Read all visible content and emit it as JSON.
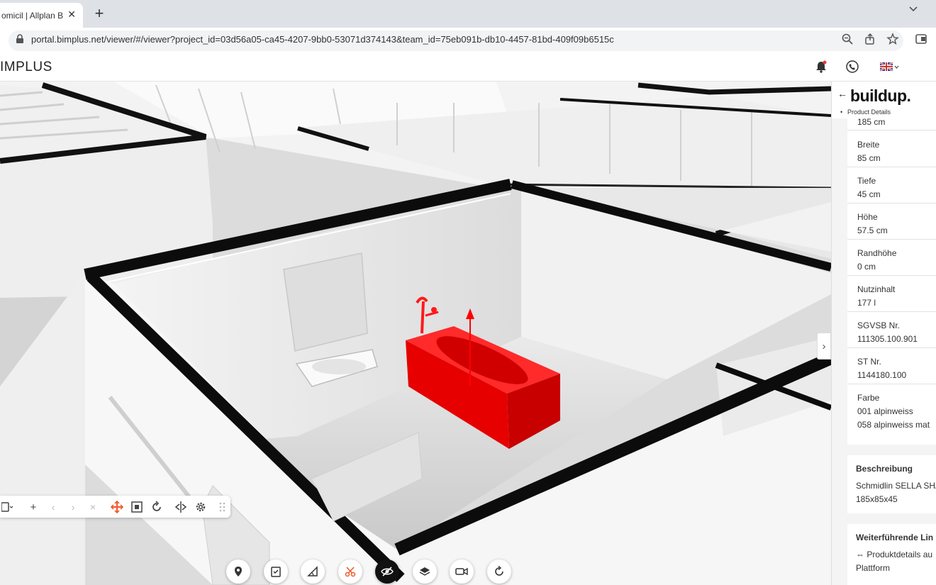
{
  "browser": {
    "tab_title": "omicil | Allplan B",
    "tab_close": "✕",
    "new_tab": "+",
    "url": "portal.bimplus.net/viewer/#/viewer?project_id=03d56a05-ca45-4207-9bb0-53071d374143&team_id=75eb091b-db10-4457-81bd-409f09b6515c"
  },
  "app": {
    "logo": "IMPLUS"
  },
  "toolbar": {
    "plus": "+",
    "prev": "‹",
    "next": "›",
    "clear": "×"
  },
  "panel": {
    "back": "←",
    "brand": "buildup.",
    "subtitle": "Product Details",
    "subtitle_marker": "•",
    "attributes": [
      {
        "label": "",
        "value": "185 cm"
      },
      {
        "label": "Breite",
        "value": "85 cm"
      },
      {
        "label": "Tiefe",
        "value": "45 cm"
      },
      {
        "label": "Höhe",
        "value": "57.5 cm"
      },
      {
        "label": "Randhöhe",
        "value": "0 cm"
      },
      {
        "label": "Nutzinhalt",
        "value": "177 l"
      },
      {
        "label": "SGVSB Nr.",
        "value": "111305.100.901"
      },
      {
        "label": "ST Nr.",
        "value": "1144180.100"
      },
      {
        "label": "Farbe",
        "value": "001 alpinweiss",
        "value2": "058 alpinweiss mat"
      }
    ],
    "beschreibung": {
      "heading": "Beschreibung",
      "line1": "Schmidlin SELLA SHA",
      "line2": "185x85x45"
    },
    "links": {
      "heading": "Weiterführende Lin",
      "line1": "⇔ Produktdetails au",
      "line2": "Plattform"
    },
    "collapse": "›"
  },
  "colors": {
    "accent_red": "#ff0000",
    "toolbar_orange": "#ee5a2a",
    "chrome_gray": "#dee1e6"
  }
}
